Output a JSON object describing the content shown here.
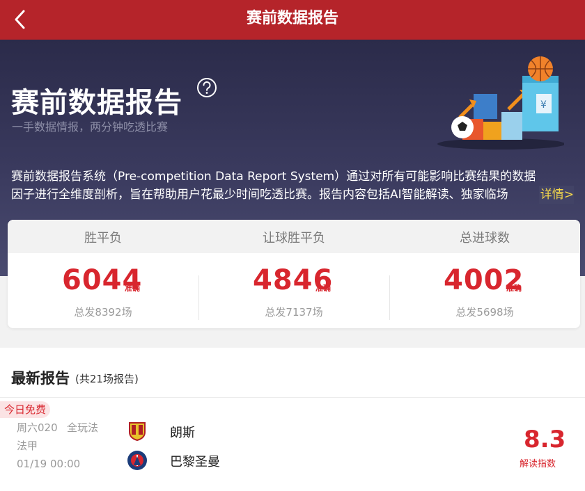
{
  "header": {
    "title": "赛前数据报告",
    "back_icon": "chevron-left-icon"
  },
  "hero": {
    "title": "赛前数据报告",
    "help_icon": "question-circle-icon",
    "subtitle": "一手数据情报，两分钟吃透比赛",
    "description": "赛前数据报告系统（Pre-competition Data Report System）通过对所有可能影响比赛结果的数据因子进行全维度剖析，旨在帮助用户花最少时间吃透比赛。报告内容包括AI智能解读、独家临场",
    "more_link": "详情>"
  },
  "stats": [
    {
      "label": "胜平负",
      "value": "6044",
      "unit": "准确",
      "total": "总发8392场"
    },
    {
      "label": "让球胜平负",
      "value": "4846",
      "unit": "准确",
      "total": "总发7137场"
    },
    {
      "label": "总进球数",
      "value": "4002",
      "unit": "准确",
      "total": "总发5698场"
    }
  ],
  "reports": {
    "title": "最新报告",
    "count": "(共21场报告)",
    "items": [
      {
        "badge": "今日免费",
        "match_no": "周六020",
        "play_type": "全玩法",
        "league": "法甲",
        "time": "01/19 00:00",
        "home": "朗斯",
        "away": "巴黎圣曼",
        "score": "8.3",
        "score_label": "解读指数"
      }
    ]
  },
  "colors": {
    "brand_red": "#b5242a",
    "accent_red": "#d8262e",
    "link_yellow": "#f6d94a",
    "hero_dark": "#2b2b4a"
  }
}
